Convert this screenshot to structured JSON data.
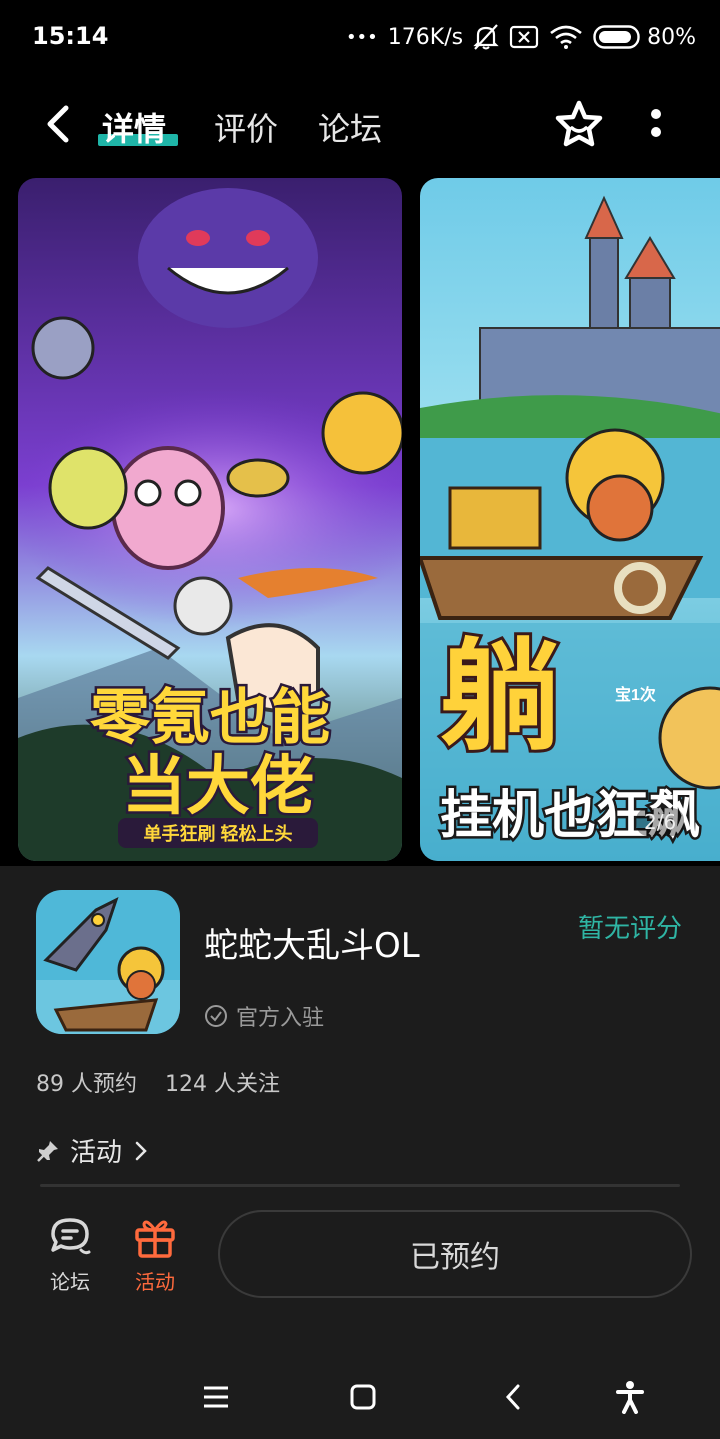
{
  "status_bar": {
    "time": "15:14",
    "net_speed": "176K/s",
    "battery": "80%",
    "dots": "•••"
  },
  "header": {
    "tabs": [
      {
        "label": "详情",
        "active": true
      },
      {
        "label": "评价",
        "active": false
      },
      {
        "label": "论坛",
        "active": false
      }
    ],
    "accent": "#1fb5a8"
  },
  "gallery": {
    "counter": "2/6",
    "shots": [
      {
        "headline_line1": "零氪也能",
        "headline_line2": "当大佬",
        "tagline": "单手狂刷 轻松上头"
      },
      {
        "headline_big": "躺",
        "headline_line2": "挂机也狂飙",
        "corner_text": "宝1次"
      }
    ]
  },
  "app": {
    "name": "蛇蛇大乱斗OL",
    "rating": "暂无评分",
    "official": "官方入驻",
    "reservations": "89 人预约",
    "followers": "124 人关注",
    "activity_link": "活动"
  },
  "actions": {
    "forum_label": "论坛",
    "events_label": "活动",
    "reserved_label": "已预约",
    "events_color": "#ff6a3d"
  },
  "colors": {
    "teal": "#2fb5a4",
    "background": "#1c1c1c"
  }
}
